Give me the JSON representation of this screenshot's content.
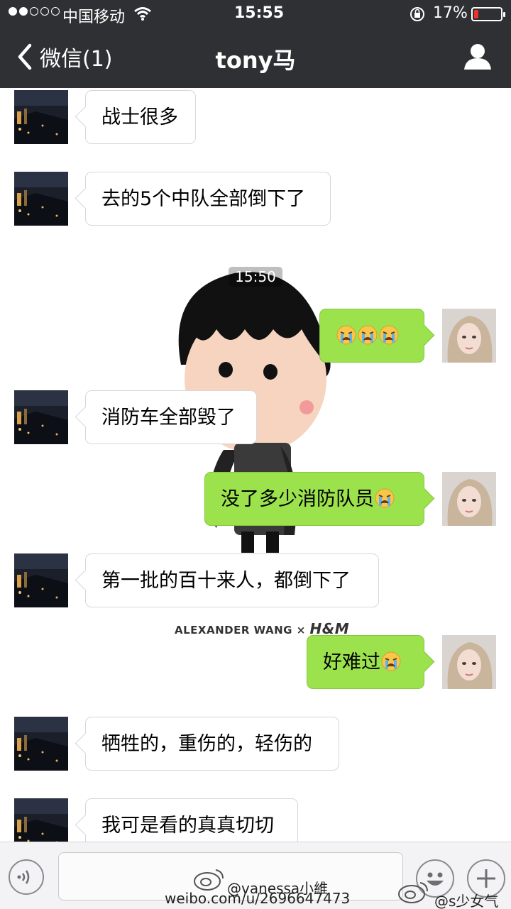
{
  "status_bar": {
    "carrier": "中国移动",
    "time": "15:55",
    "battery_percent": "17%",
    "battery_level": 0.17,
    "signal_strength": 2,
    "signal_max": 5
  },
  "nav": {
    "back_label": "微信(1)",
    "title": "tony马",
    "profile_icon": "person-icon"
  },
  "chat": {
    "timestamp": "15:50",
    "messages": [
      {
        "side": "left",
        "text": "战士很多"
      },
      {
        "side": "left",
        "text": "去的5个中队全部倒下了"
      },
      {
        "side": "right",
        "text": "",
        "emoji_count": 3
      },
      {
        "side": "left",
        "text": "消防车全部毁了"
      },
      {
        "side": "right",
        "text": "没了多少消防队员",
        "emoji_count": 1
      },
      {
        "side": "left",
        "text": "第一批的百十来人，都倒下了"
      },
      {
        "side": "right",
        "text": "好难过",
        "emoji_count": 1
      },
      {
        "side": "left",
        "text": "牺牲的，重伤的，轻伤的"
      },
      {
        "side": "left",
        "text": "我可是看的真真切切"
      }
    ]
  },
  "watermarks": {
    "brand_a": "ALEXANDER WANG",
    "brand_x": "×",
    "brand_b": "H&M",
    "weibo_handle": "@vanessa小維",
    "weibo_url": "weibo.com/u/2696647473",
    "weibo_handle_2": "@s少女气糖"
  },
  "colors": {
    "nav_bg": "#2f3033",
    "bubble_self": "#9ce24d",
    "bubble_other": "#ffffff",
    "battery_low": "#e8352c"
  }
}
